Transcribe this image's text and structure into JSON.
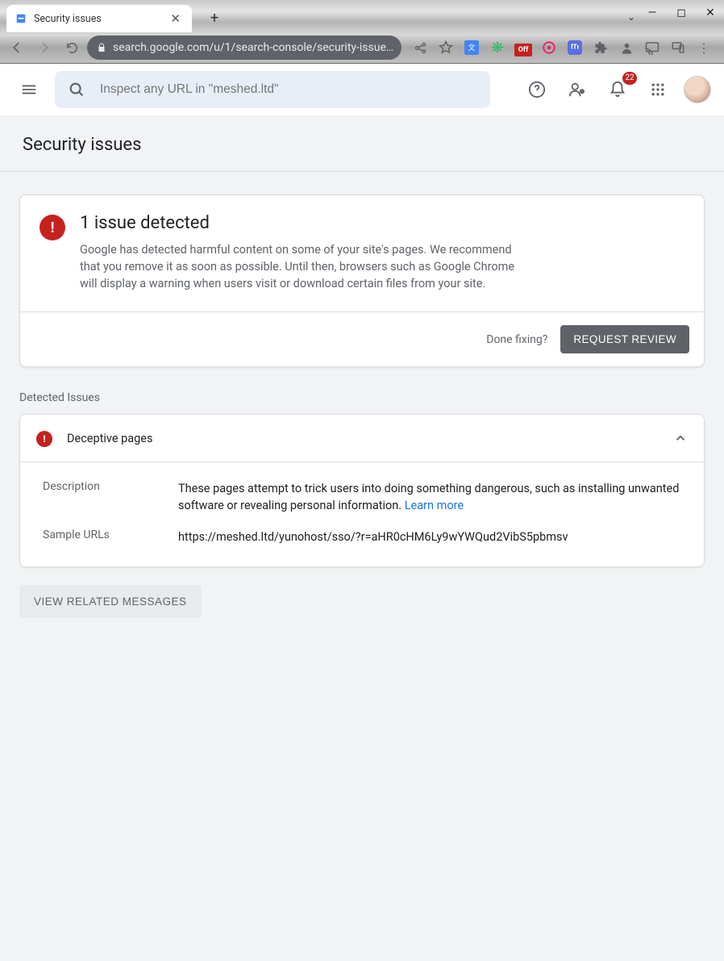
{
  "browser": {
    "tab_title": "Security issues",
    "url": "search.google.com/u/1/search-console/security-issue…",
    "off_badge": "Off",
    "dropdown_caret": "⌄"
  },
  "header": {
    "search_placeholder": "Inspect any URL in \"meshed.ltd\"",
    "notification_count": "22"
  },
  "page": {
    "title": "Security issues"
  },
  "alert": {
    "heading": "1 issue detected",
    "body": "Google has detected harmful content on some of your site's pages. We recommend that you remove it as soon as possible. Until then, browsers such as Google Chrome will display a warning when users visit or download certain files from your site.",
    "done_text": "Done fixing?",
    "button": "REQUEST REVIEW"
  },
  "issues": {
    "section_label": "Detected Issues",
    "item": {
      "title": "Deceptive pages",
      "desc_label": "Description",
      "desc_text": "These pages attempt to trick users into doing something dangerous, such as installing unwanted software or revealing personal information. ",
      "learn_more": "Learn more",
      "sample_label": "Sample URLs",
      "sample_url": "https://meshed.ltd/yunohost/sso/?r=aHR0cHM6Ly9wYWQud2VibS5pbmsv"
    }
  },
  "related_button": "VIEW RELATED MESSAGES"
}
